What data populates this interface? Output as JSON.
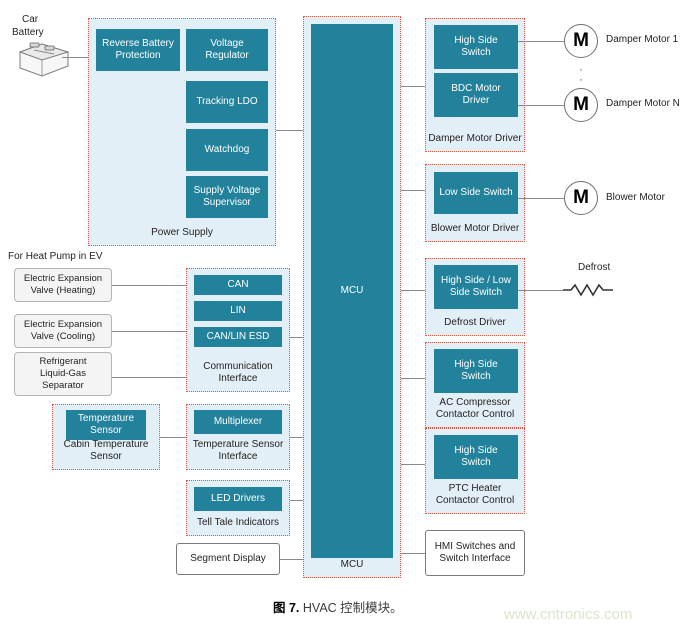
{
  "figure": {
    "caption_prefix": "图 7.",
    "caption_text": "HVAC 控制模块。",
    "watermark": "www.cntronics.com"
  },
  "colors": {
    "teal_block": "#22819b",
    "panel_fill": "#e2eff6",
    "panel_border": "#e8543f",
    "wire": "#8a8a8a",
    "gray_box_fill": "#f4f4f4",
    "watermark": "#d9e6c8"
  },
  "sources": {
    "car_battery_label_line1": "Car",
    "car_battery_label_line2": "Battery",
    "car_battery_icon": "car-battery-icon",
    "heat_pump_note": "For Heat Pump in EV",
    "heat_pump_inputs": [
      {
        "line1": "Electric Expansion",
        "line2": "Valve (Heating)"
      },
      {
        "line1": "Electric Expansion",
        "line2": "Valve (Cooling)"
      },
      {
        "line1": "Refrigerant",
        "line2": "Liquid-Gas",
        "line3": "Separator"
      }
    ]
  },
  "power_supply": {
    "panel_label": "Power Supply",
    "blocks": [
      {
        "line1": "Reverse Battery",
        "line2": "Protection"
      },
      {
        "line1": "Voltage",
        "line2": "Regulator"
      },
      {
        "line1": "Tracking LDO"
      },
      {
        "line1": "Watchdog"
      },
      {
        "line1": "Supply Voltage",
        "line2": "Supervisor"
      }
    ]
  },
  "cabin_sensor": {
    "panel_label_line1": "Cabin Temperature",
    "panel_label_line2": "Sensor",
    "block_line1": "Temperature",
    "block_line2": "Sensor"
  },
  "mcu": {
    "block_label": "MCU",
    "panel_label": "MCU"
  },
  "middle_column": {
    "communication_interface": {
      "panel_label_line1": "Communication",
      "panel_label_line2": "Interface",
      "blocks": [
        "CAN",
        "LIN",
        "CAN/LIN ESD"
      ]
    },
    "temperature_sensor_interface": {
      "panel_label_line1": "Temperature Sensor",
      "panel_label_line2": "Interface",
      "block": "Multiplexer"
    },
    "tell_tale_indicators": {
      "panel_label": "Tell Tale Indicators",
      "block": "LED Drivers"
    },
    "segment_display": {
      "label": "Segment Display"
    }
  },
  "right_column": {
    "damper_motor_driver": {
      "panel_label": "Damper Motor Driver",
      "blocks": [
        {
          "line1": "High Side",
          "line2": "Switch"
        },
        {
          "line1": "BDC Motor",
          "line2": "Driver"
        }
      ]
    },
    "blower_motor_driver": {
      "panel_label": "Blower Motor Driver",
      "block": "Low Side Switch"
    },
    "defrost_driver": {
      "panel_label": "Defrost Driver",
      "block_line1": "High Side / Low",
      "block_line2": "Side Switch"
    },
    "ac_compressor_contactor_control": {
      "panel_label_line1": "AC Compressor",
      "panel_label_line2": "Contactor Control",
      "block_line1": "High Side",
      "block_line2": "Switch"
    },
    "ptc_heater_contactor_control": {
      "panel_label_line1": "PTC Heater",
      "panel_label_line2": "Contactor Control",
      "block_line1": "High Side",
      "block_line2": "Switch"
    },
    "hmi_switches": {
      "line1": "HMI Switches and",
      "line2": "Switch Interface"
    }
  },
  "loads": {
    "motor_symbol": "M",
    "damper_motor_1": "Damper Motor 1",
    "damper_motor_n": "Damper Motor N",
    "blower_motor": "Blower Motor",
    "vertical_ellipsis": "·",
    "defrost_label": "Defrost",
    "defrost_symbol": "resistor-icon"
  }
}
